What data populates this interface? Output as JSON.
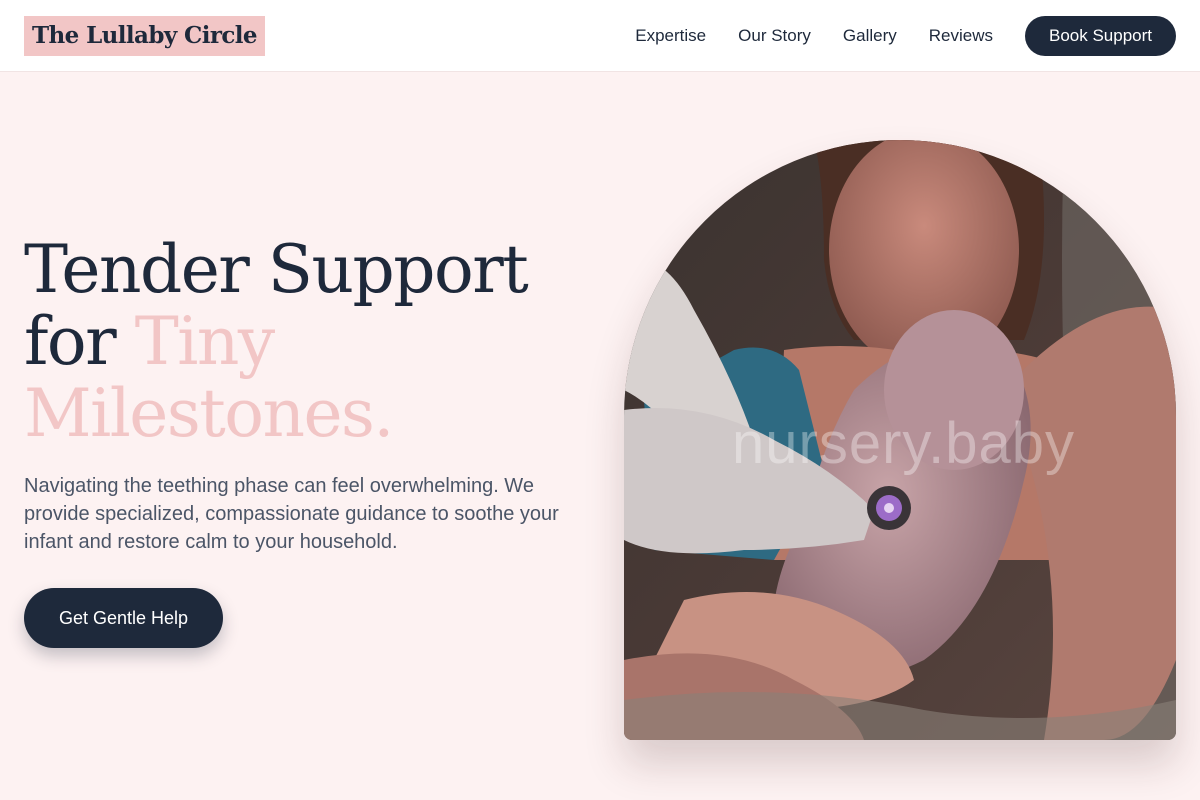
{
  "header": {
    "logo": "The Lullaby Circle",
    "nav": [
      "Expertise",
      "Our Story",
      "Gallery",
      "Reviews"
    ],
    "cta": "Book Support"
  },
  "hero": {
    "title_line1": "Tender Support",
    "title_for": "for ",
    "title_accent_1": "Tiny",
    "title_accent_2": "Milestones.",
    "subtitle": "Navigating the teething phase can feel overwhelming. We provide specialized, compassionate guidance to soothe your infant and restore calm to your household.",
    "cta": "Get Gentle Help",
    "image_watermark": "nursery.baby"
  },
  "colors": {
    "navy": "#1e293b",
    "pink": "#f2c6c6",
    "background": "#fdf2f2",
    "body_text": "#4b5567"
  }
}
